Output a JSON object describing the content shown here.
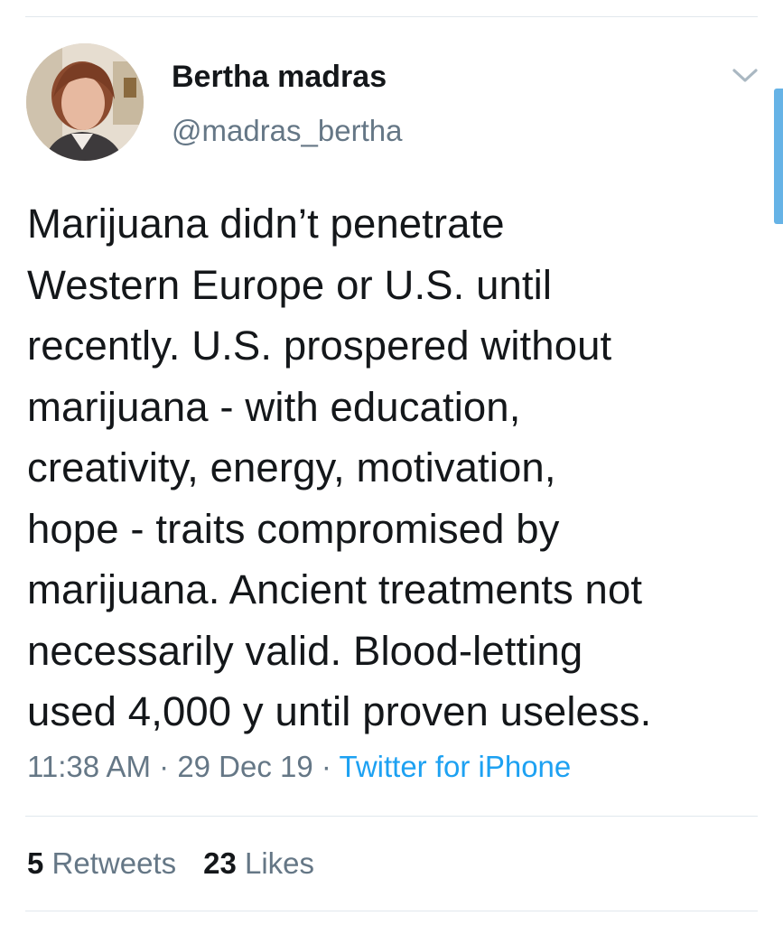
{
  "author": {
    "display_name": "Bertha madras",
    "handle": "@madras_bertha"
  },
  "tweet": {
    "text": "Marijuana didn’t penetrate\nWestern Europe or U.S. until\nrecently. U.S. prospered without\nmarijuana - with education,\ncreativity, energy, motivation,\nhope - traits compromised by\nmarijuana. Ancient treatments not\nnecessarily valid. Blood-letting\nused 4,000 y until proven useless.",
    "time": "11:38 AM",
    "date": "29 Dec 19",
    "separator": " · ",
    "source": "Twitter for iPhone"
  },
  "stats": {
    "retweets_count": "5",
    "retweets_label": "Retweets",
    "likes_count": "23",
    "likes_label": "Likes"
  },
  "icons": {
    "menu": "chevron-down-icon"
  },
  "colors": {
    "text": "#14171a",
    "secondary": "#657786",
    "link": "#1da1f2",
    "divider": "#e1e8ed"
  }
}
